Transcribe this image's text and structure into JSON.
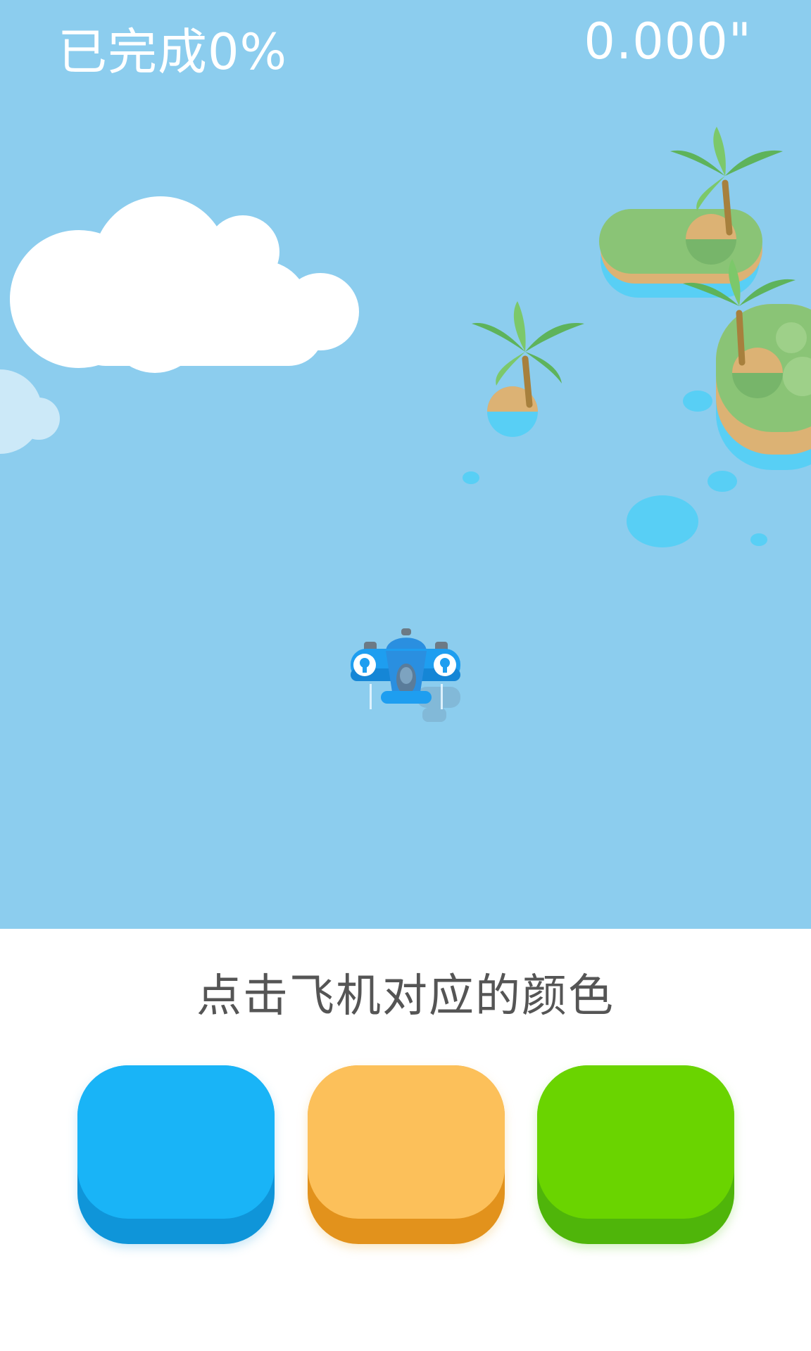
{
  "hud": {
    "progress_text": "已完成0%",
    "timer_text": "0.000\""
  },
  "instruction": {
    "text": "点击飞机对应的颜色"
  },
  "color_buttons": [
    {
      "name": "blue",
      "color": "#19b4f7"
    },
    {
      "name": "orange",
      "color": "#fcc05a"
    },
    {
      "name": "green",
      "color": "#6ad400"
    }
  ],
  "colors": {
    "sky": "#8ccdee",
    "plane": "#1e9ef0",
    "island_grass": "#8ac476",
    "island_sand": "#dcb274",
    "water": "#58cff5"
  },
  "icons": [
    "cloud-icon",
    "palm-tree-icon",
    "island-icon",
    "airplane-icon"
  ]
}
